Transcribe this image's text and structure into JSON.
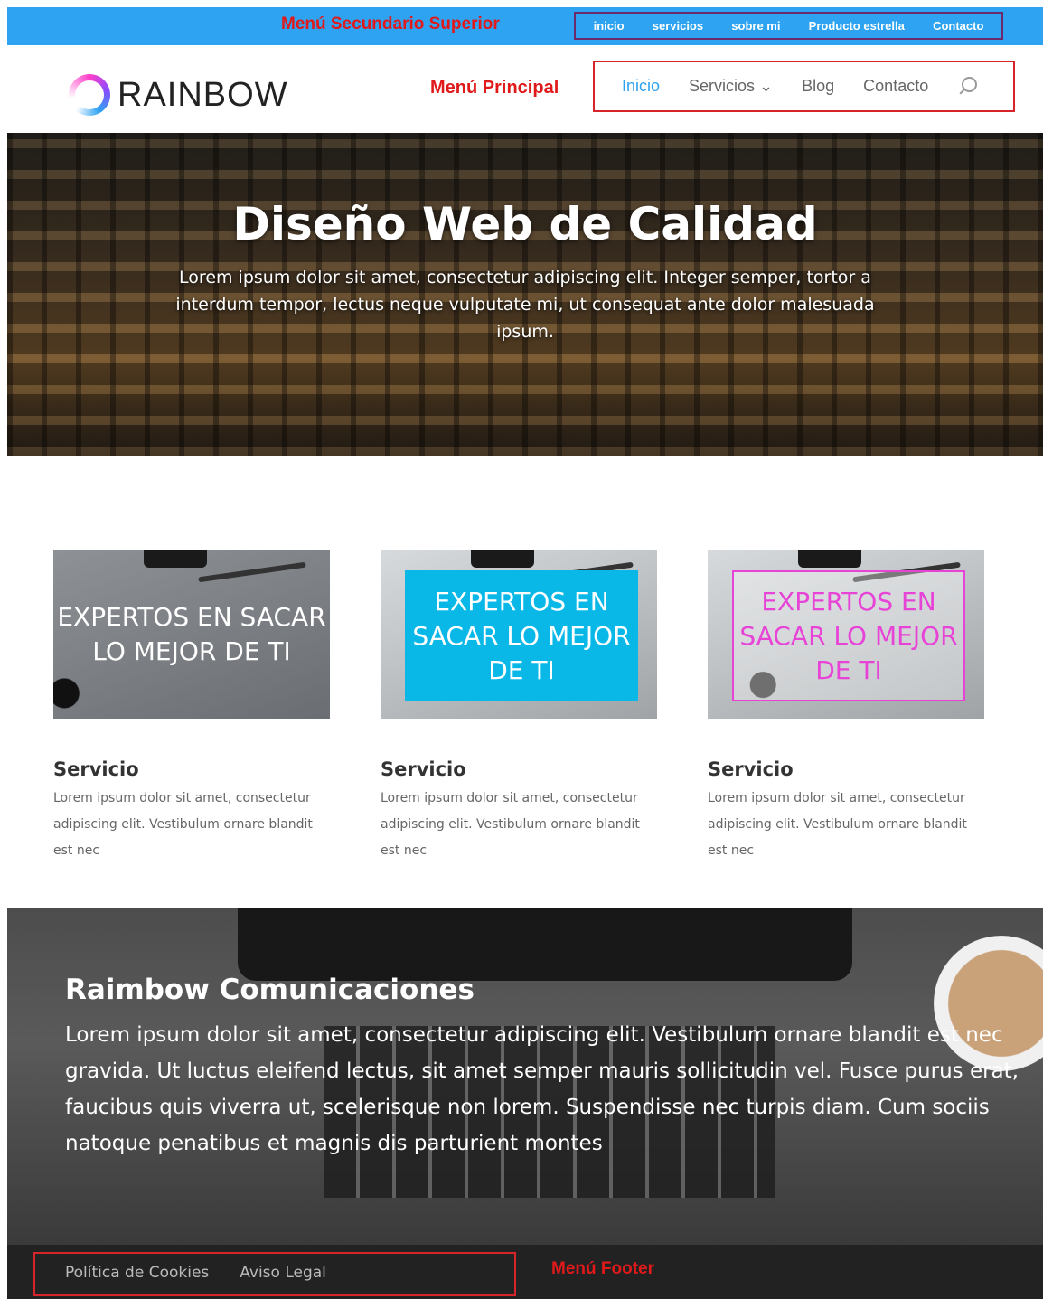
{
  "annotations": {
    "top_menu": "Menú Secundario Superior",
    "main_menu": "Menú Principal",
    "footer_menu": "Menú Footer"
  },
  "secondary_menu": [
    "inicio",
    "servicios",
    "sobre mi",
    "Producto estrella",
    "Contacto"
  ],
  "logo": {
    "text": "RAINBOW"
  },
  "main_menu": {
    "items": [
      {
        "label": "Inicio",
        "active": true
      },
      {
        "label": "Servicios ⌄",
        "active": false
      },
      {
        "label": "Blog",
        "active": false
      },
      {
        "label": "Contacto",
        "active": false
      }
    ],
    "search_icon": "search-icon"
  },
  "hero": {
    "title": "Diseño Web de Calidad",
    "subtitle": "Lorem ipsum dolor sit amet, consectetur adipiscing elit. Integer semper, tortor a interdum tempor, lectus neque vulputate mi, ut consequat ante dolor malesuada ipsum."
  },
  "services": [
    {
      "overlay": "EXPERTOS EN SACAR LO MEJOR DE TI",
      "title": "Servicio",
      "text": "Lorem ipsum dolor sit amet, consectetur adipiscing elit. Vestibulum ornare blandit est nec"
    },
    {
      "overlay": "EXPERTOS EN SACAR LO MEJOR DE TI",
      "title": "Servicio",
      "text": "Lorem ipsum dolor sit amet, consectetur adipiscing elit. Vestibulum ornare blandit est nec"
    },
    {
      "overlay": "EXPERTOS EN SACAR LO MEJOR DE TI",
      "title": "Servicio",
      "text": "Lorem ipsum dolor sit amet, consectetur adipiscing elit. Vestibulum ornare blandit est nec"
    }
  ],
  "about": {
    "title": "Raimbow Comunicaciones",
    "text": "Lorem ipsum dolor sit amet, consectetur adipiscing elit. Vestibulum ornare blandit est nec gravida. Ut luctus eleifend lectus, sit amet semper mauris sollicitudin vel. Fusce purus erat, faucibus quis viverra ut, scelerisque non lorem. Suspendisse nec turpis diam. Cum sociis natoque penatibus et magnis dis parturient montes"
  },
  "footer_menu": [
    "Política de Cookies",
    "Aviso Legal"
  ],
  "colors": {
    "accent": "#2ea3f2",
    "annotation_red": "#e0191b",
    "card_cyan": "#0ab8e8",
    "card_magenta": "#e843d7",
    "footer_bg": "#222222"
  }
}
